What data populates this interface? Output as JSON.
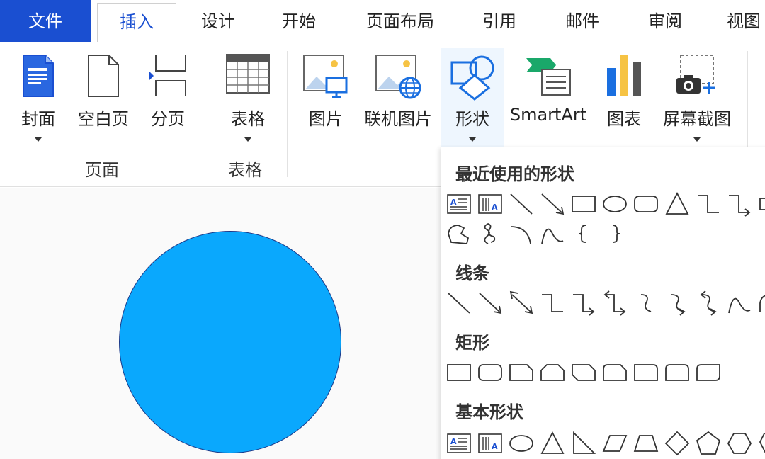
{
  "tabs": [
    {
      "label": "文件",
      "name": "tab-file"
    },
    {
      "label": "插入",
      "name": "tab-insert"
    },
    {
      "label": "设计",
      "name": "tab-design"
    },
    {
      "label": "开始",
      "name": "tab-start"
    },
    {
      "label": "页面布局",
      "name": "tab-page-layout"
    },
    {
      "label": "引用",
      "name": "tab-references"
    },
    {
      "label": "邮件",
      "name": "tab-mailings"
    },
    {
      "label": "审阅",
      "name": "tab-review"
    },
    {
      "label": "视图",
      "name": "tab-view"
    }
  ],
  "ribbon": {
    "pages_group": {
      "label": "页面",
      "cover": "封面",
      "blank_page": "空白页",
      "page_break": "分页"
    },
    "table_group": {
      "label": "表格",
      "table": "表格"
    },
    "illustrations": {
      "picture": "图片",
      "online_picture": "联机图片",
      "shapes": "形状",
      "smartart": "SmartArt",
      "chart": "图表",
      "screenshot": "屏幕截图"
    }
  },
  "shapes_panel": {
    "sections": {
      "recent": "最近使用的形状",
      "lines": "线条",
      "rectangles": "矩形",
      "basic": "基本形状"
    },
    "icons": {
      "recent_row1": [
        "text-box-icon",
        "vertical-text-box-icon",
        "line-icon",
        "arrow-line-icon",
        "rectangle-icon",
        "oval-icon",
        "rounded-rectangle-icon",
        "triangle-icon",
        "elbow-connector-icon",
        "elbow-arrow-connector-icon",
        "partial-shape-icon"
      ],
      "recent_row2": [
        "freeform-icon",
        "scribble-icon",
        "arc-icon",
        "curve-icon",
        "left-brace-icon",
        "right-brace-icon"
      ],
      "lines_row": [
        "line-icon",
        "arrow-line-icon",
        "double-arrow-line-icon",
        "elbow-connector-icon",
        "elbow-arrow-connector-icon",
        "elbow-double-arrow-connector-icon",
        "curved-connector-icon",
        "curved-arrow-connector-icon",
        "curved-double-arrow-connector-icon",
        "curve-icon",
        "freeform-icon"
      ],
      "rect_row": [
        "rectangle-icon",
        "rounded-rectangle-icon",
        "snip-single-corner-rectangle-icon",
        "snip-same-side-rectangle-icon",
        "snip-diagonal-rectangle-icon",
        "snip-round-rectangle-icon",
        "round-single-corner-rectangle-icon",
        "round-same-side-rectangle-icon",
        "round-diagonal-rectangle-icon"
      ],
      "basic_row": [
        "text-box-icon",
        "vertical-text-box-icon",
        "oval-icon",
        "triangle-icon",
        "right-triangle-icon",
        "parallelogram-icon",
        "trapezoid-icon",
        "diamond-icon",
        "pentagon-icon",
        "hexagon-icon",
        "heptagon-icon"
      ]
    }
  },
  "colors": {
    "accent": "#1a4fd1",
    "circle_fill": "#0aa8fd",
    "circle_stroke": "#1b3a8a"
  }
}
